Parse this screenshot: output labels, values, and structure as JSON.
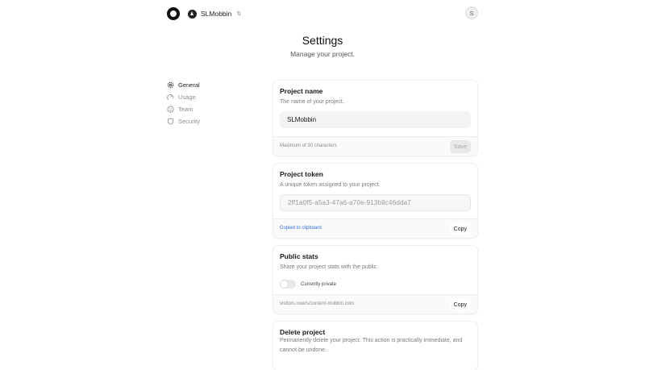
{
  "header": {
    "project_name": "SLMobbin",
    "switch_glyph": "⇅",
    "avatar_initial": "S"
  },
  "page": {
    "title": "Settings",
    "subtitle": "Manage your project."
  },
  "sidebar": {
    "items": [
      {
        "label": "General",
        "icon": "gear-icon",
        "active": true
      },
      {
        "label": "Usage",
        "icon": "usage-icon",
        "active": false
      },
      {
        "label": "Team",
        "icon": "smiley-icon",
        "active": false
      },
      {
        "label": "Security",
        "icon": "shield-icon",
        "active": false
      }
    ]
  },
  "project_name_card": {
    "title": "Project name",
    "description": "The name of your project.",
    "value": "SLMobbin",
    "hint": "Maximum of 30 characters",
    "save_label": "Save"
  },
  "project_token_card": {
    "title": "Project token",
    "description": "A unique token assigned to your project.",
    "token": "2ff1a0f5-a5a3-47a6-a70e-913b9c46dda7",
    "copied_message": "Copied to clipboard",
    "copy_label": "Copy"
  },
  "public_stats_card": {
    "title": "Public stats",
    "description": "Share your project stats with the public.",
    "toggle_label": "Currently private",
    "toggle_on": false,
    "url": "visitors.now/s/content-mobbin.com",
    "copy_label": "Copy"
  },
  "delete_card": {
    "title": "Delete project",
    "description": "Permanently delete your project. This action is practically immediate, and cannot be undone."
  },
  "colors": {
    "link": "#2d6fd2",
    "muted_text": "#7a7a7a"
  }
}
